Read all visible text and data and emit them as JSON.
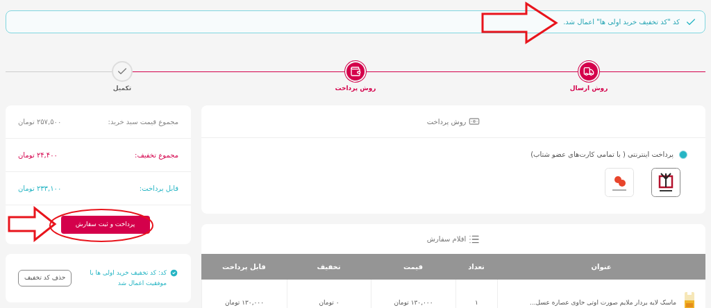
{
  "alert": {
    "text": "کد \"کد تخفیف خرید اولی ها\" اعمال شد."
  },
  "steps": [
    {
      "label": "روش ارسال",
      "done": true,
      "kind": "truck"
    },
    {
      "label": "روش پرداخت",
      "done": true,
      "kind": "wallet"
    },
    {
      "label": "تکمیل",
      "done": false,
      "kind": "check"
    }
  ],
  "payment": {
    "title": "روش پرداخت",
    "methods": [
      {
        "label": "پرداخت اینترنتی ( با تمامی کارت‌های عضو شتاب)",
        "selected": true
      }
    ]
  },
  "summary": {
    "rows": [
      {
        "label": "مجموع قیمت سبد خرید:",
        "value": "۲۵۷,۵۰۰ تومان",
        "kind": "total"
      },
      {
        "label": "مجموع تخفیف:",
        "value": "۲۴,۴۰۰ تومان",
        "kind": "discount"
      },
      {
        "label": "قابل پرداخت:",
        "value": "۲۳۳,۱۰۰ تومان",
        "kind": "payable"
      }
    ],
    "button": "پرداخت و ثبت سفارش"
  },
  "coupon": {
    "message": "کد: کد تخفیف خرید اولی ها با موفقیت اعمال شد",
    "remove": "حذف کد تخفیف"
  },
  "order": {
    "title": "اقلام سفارش",
    "columns": [
      "عنوان",
      "تعداد",
      "قیمت",
      "تخفیف",
      "قابل پرداخت"
    ],
    "rows": [
      {
        "cells": [
          "ماسک لایه بردار ملایم صورت اوتی حاوی عصاره عسل...",
          "۱",
          "۱۳۰,۰۰۰ تومان",
          "۰ تومان",
          "۱۳۰,۰۰۰ تومان"
        ]
      }
    ]
  }
}
